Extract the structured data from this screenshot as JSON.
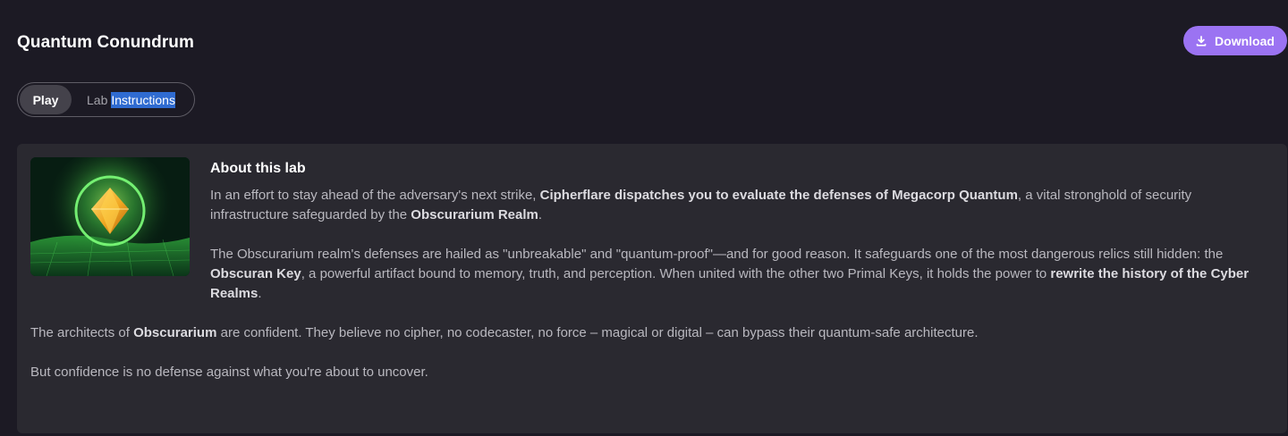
{
  "header": {
    "title": "Quantum Conundrum",
    "download_label": "Download",
    "download_icon": "download-icon"
  },
  "tabs": {
    "play_label": "Play",
    "instructions_word1": "Lab",
    "instructions_word2": "Instructions"
  },
  "about": {
    "title": "About this lab",
    "image_icon": "glowing-crystal-orb",
    "p1": {
      "t1": "In an effort to stay ahead of the adversary's next strike, ",
      "b1": "Cipherflare dispatches you to evaluate the defenses of Megacorp Quantum",
      "t2": ", a vital stronghold of security infrastructure safeguarded by the ",
      "b2": "Obscurarium Realm",
      "t3": "."
    },
    "p2": {
      "t1": "The Obscurarium realm's defenses are hailed as \"unbreakable\" and \"quantum-proof\"—and for good reason. It safeguards one of the most dangerous relics still hidden: the ",
      "b1": "Obscuran Key",
      "t2": ", a powerful artifact bound to memory, truth, and perception. When united with the other two Primal Keys, it holds the power to ",
      "b2": "rewrite the history of the Cyber Realms",
      "t3": "."
    },
    "p3": {
      "t1": "The architects of ",
      "b1": "Obscurarium",
      "t2": " are confident. They believe no cipher, no codecaster, no force – magical or digital – can bypass their quantum-safe architecture."
    },
    "p4": "But confidence is no defense against what you're about to uncover."
  },
  "colors": {
    "background": "#1c1a24",
    "card": "#2a2930",
    "accent": "#9b73f2",
    "selection": "#2f6bd0"
  }
}
